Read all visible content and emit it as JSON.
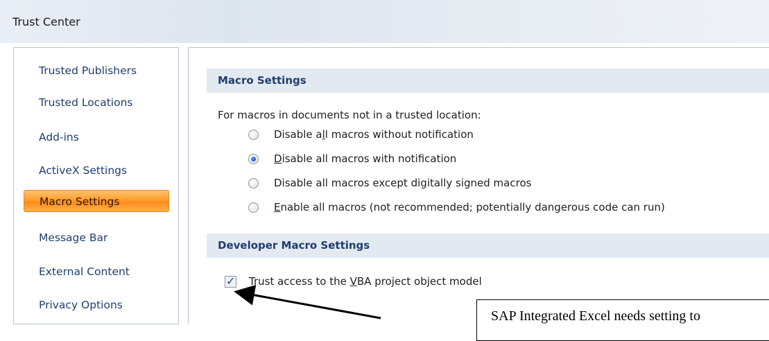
{
  "window": {
    "title": "Trust Center"
  },
  "sidebar": {
    "items": [
      {
        "label": "Trusted Publishers"
      },
      {
        "label": "Trusted Locations"
      },
      {
        "label": "Add-ins"
      },
      {
        "label": "ActiveX Settings"
      },
      {
        "label": "Macro Settings",
        "active": true
      },
      {
        "label": "Message Bar"
      },
      {
        "label": "External Content"
      },
      {
        "label": "Privacy Options"
      }
    ]
  },
  "macro_settings": {
    "header": "Macro Settings",
    "intro": "For macros in documents not in a trusted location:",
    "options": [
      {
        "pre": "Disable a",
        "u": "l",
        "post": "l macros without notification",
        "checked": false
      },
      {
        "pre": "",
        "u": "D",
        "post": "isable all macros with notification",
        "checked": true
      },
      {
        "pre": "Disable all macros except di",
        "u": "g",
        "post": "itally signed macros",
        "checked": false
      },
      {
        "pre": "",
        "u": "E",
        "post": "nable all macros (not recommended; potentially dangerous code can run)",
        "checked": false
      }
    ]
  },
  "developer": {
    "header": "Developer Macro Settings",
    "checkbox": {
      "pre": "Trust access to the ",
      "u": "V",
      "post": "BA project object model",
      "checked": true
    }
  },
  "callout": {
    "text": "SAP Integrated Excel needs setting to"
  },
  "colors": {
    "accent": "#ff9d2f",
    "header_bg": "#e3e9f1",
    "nav_text": "#203d6f"
  }
}
